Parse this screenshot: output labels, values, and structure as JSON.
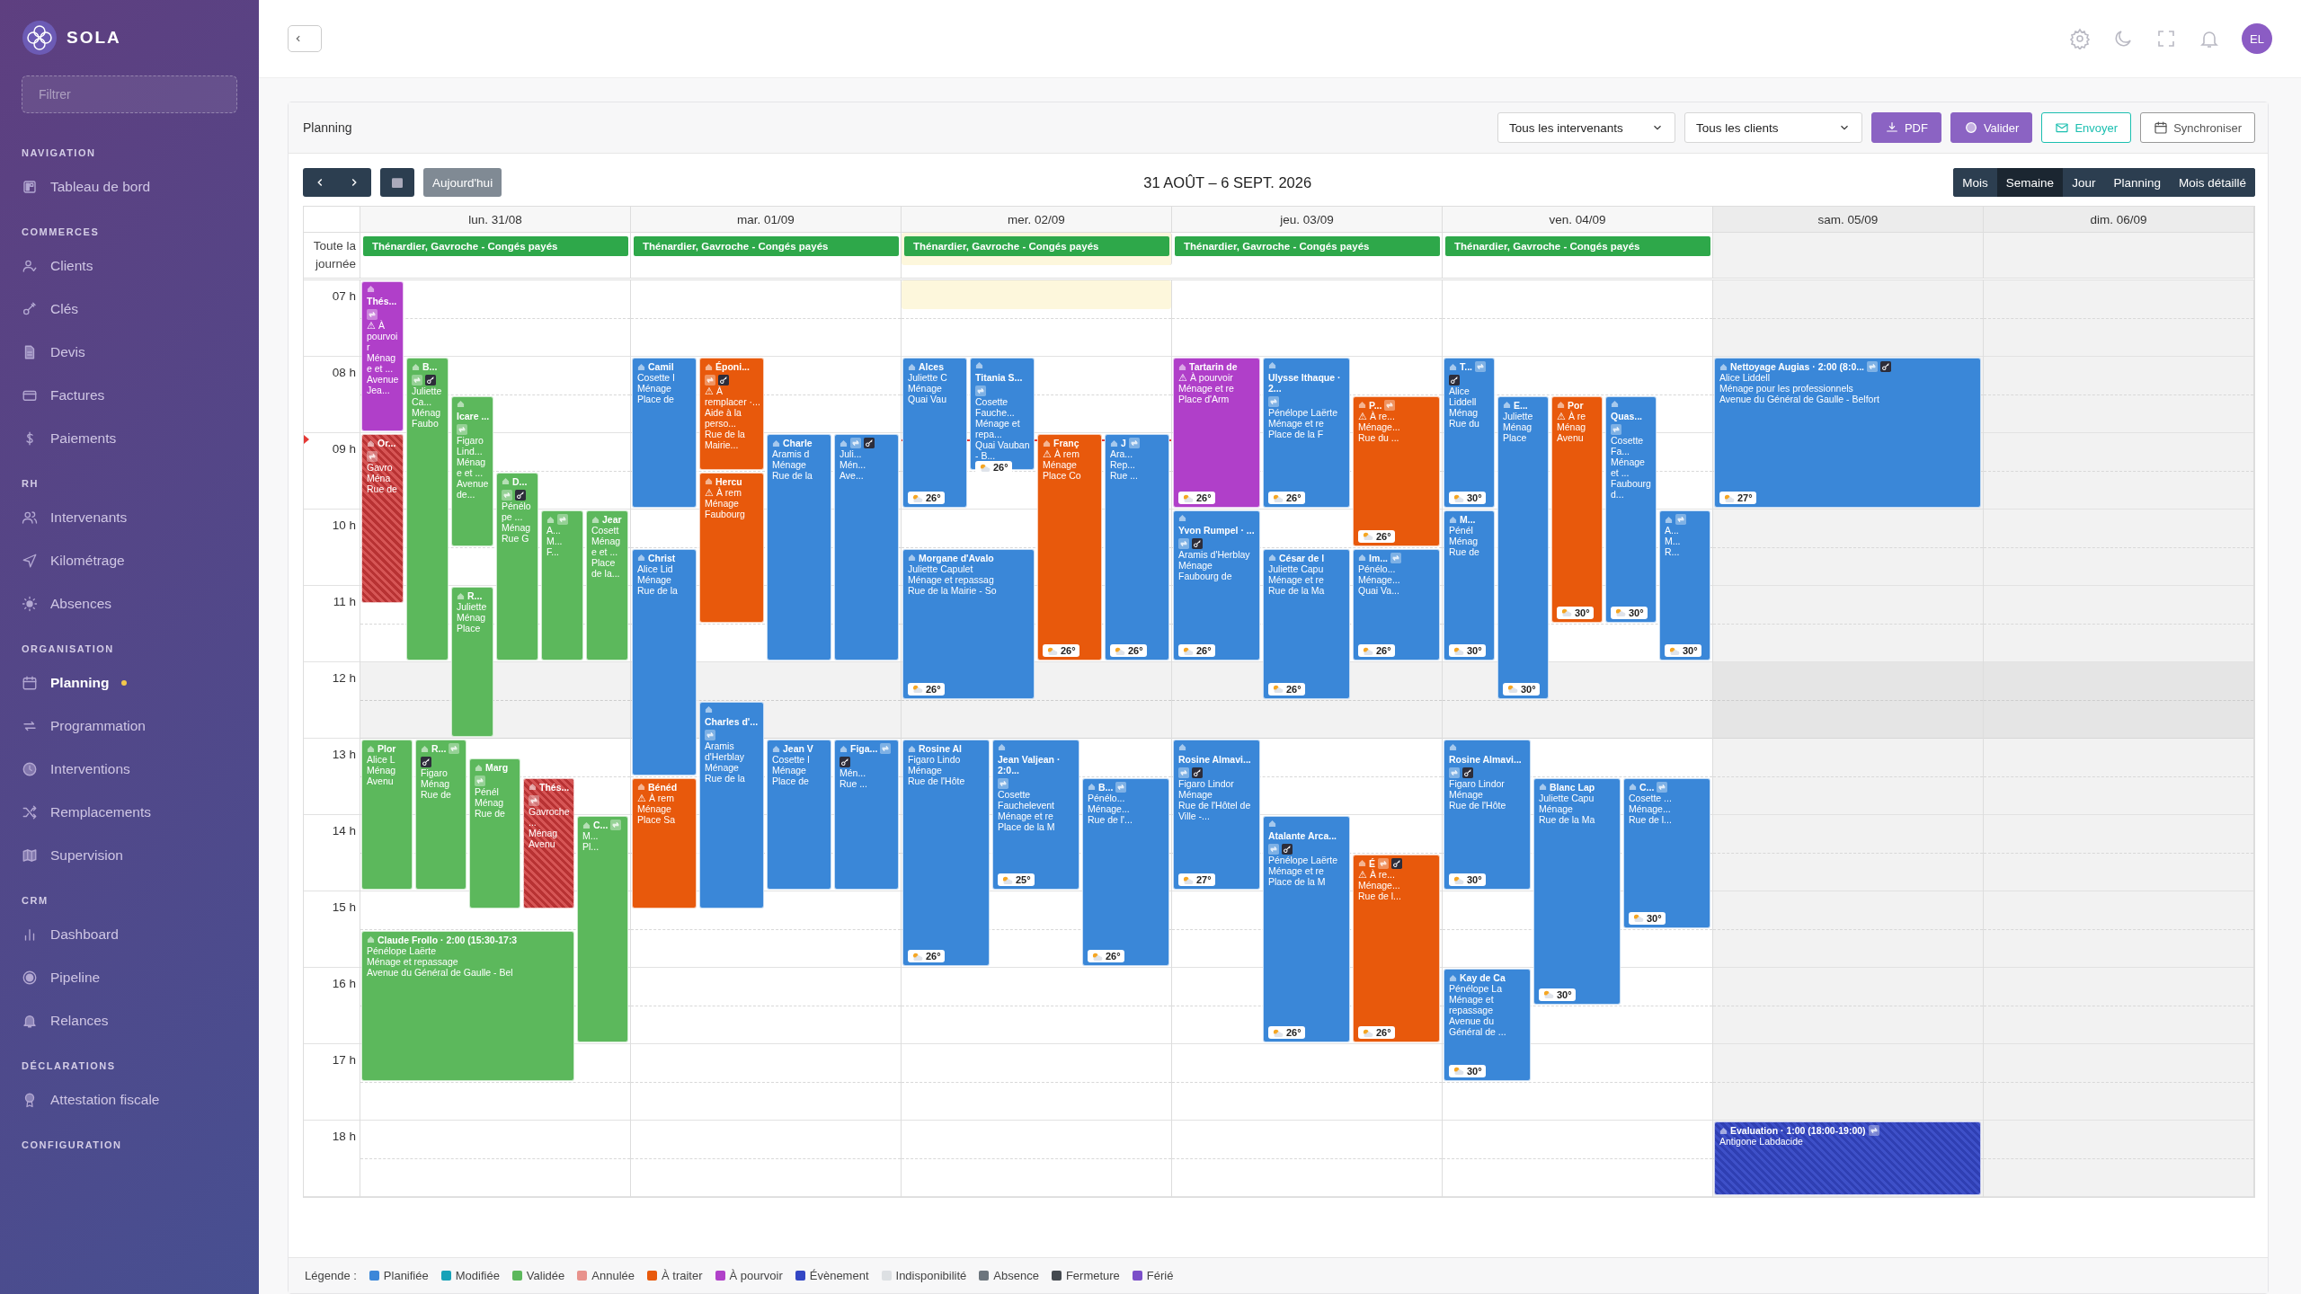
{
  "sidebar": {
    "logo": "SOLA",
    "filter": {
      "placeholder": "Filtrer"
    },
    "sections": [
      {
        "title": "NAVIGATION",
        "items": [
          {
            "label": "Tableau de bord",
            "selected": false,
            "notified": false
          }
        ]
      },
      {
        "title": "COMMERCES",
        "items": [
          {
            "label": "Clients",
            "selected": false,
            "notified": false
          },
          {
            "label": "Clés",
            "selected": false,
            "notified": false
          },
          {
            "label": "Devis",
            "selected": false,
            "notified": false
          },
          {
            "label": "Factures",
            "selected": false,
            "notified": false
          },
          {
            "label": "Paiements",
            "selected": false,
            "notified": false
          }
        ]
      },
      {
        "title": "RH",
        "items": [
          {
            "label": "Intervenants",
            "selected": false,
            "notified": false
          },
          {
            "label": "Kilométrage",
            "selected": false,
            "notified": false
          },
          {
            "label": "Absences",
            "selected": false,
            "notified": false
          }
        ]
      },
      {
        "title": "ORGANISATION",
        "items": [
          {
            "label": "Planning",
            "selected": true,
            "notified": true
          },
          {
            "label": "Programmation",
            "selected": false,
            "notified": false
          },
          {
            "label": "Interventions",
            "selected": false,
            "notified": false
          },
          {
            "label": "Remplacements",
            "selected": false,
            "notified": false
          },
          {
            "label": "Supervision",
            "selected": false,
            "notified": false
          }
        ]
      },
      {
        "title": "CRM",
        "items": [
          {
            "label": "Dashboard",
            "selected": false,
            "notified": false
          },
          {
            "label": "Pipeline",
            "selected": false,
            "notified": false
          },
          {
            "label": "Relances",
            "selected": false,
            "notified": false
          }
        ]
      },
      {
        "title": "DÉCLARATIONS",
        "items": [
          {
            "label": "Attestation fiscale",
            "selected": false,
            "notified": false
          }
        ]
      },
      {
        "title": "CONFIGURATION"
      }
    ]
  },
  "topbar": {
    "avatar": "EL"
  },
  "panel": {
    "title": "Planning",
    "filters": [
      {
        "value": "Tous les intervenants"
      },
      {
        "value": "Tous les clients"
      }
    ],
    "actions": [
      {
        "label": "PDF",
        "kind": "primary"
      },
      {
        "label": "Valider",
        "kind": "primary"
      },
      {
        "label": "Envoyer",
        "kind": "teal"
      },
      {
        "label": "Synchroniser",
        "kind": "outline"
      }
    ],
    "today_button": "Aujourd'hui",
    "range_title": "31 AOÛT – 6 SEPT. 2026",
    "views": [
      {
        "label": "Mois",
        "selected": false
      },
      {
        "label": "Semaine",
        "selected": true
      },
      {
        "label": "Jour",
        "selected": false
      },
      {
        "label": "Planning",
        "selected": false
      },
      {
        "label": "Mois détaillé",
        "selected": false
      }
    ]
  },
  "calendar": {
    "all_day_label": "Toute la journée",
    "hours": [
      "07 h",
      "08 h",
      "09 h",
      "10 h",
      "11 h",
      "12 h",
      "13 h",
      "14 h",
      "15 h",
      "16 h",
      "17 h",
      "18 h"
    ],
    "days": [
      {
        "label": "lun. 31/08",
        "today": false,
        "weekend": false,
        "all_day": [
          "Thénardier, Gavroche - Congés payés"
        ],
        "events": [
          {
            "kind": "a_pourvoir",
            "title": "Thés...",
            "lines": [
              "⚠ À pourvoir",
              "Ménage et ...",
              "Avenue Jea..."
            ],
            "repeat": true,
            "key": false
          },
          {
            "kind": "validee",
            "title": "B...",
            "lines": [
              "Juliette Ca...",
              "Ménag",
              "Faubo"
            ],
            "repeat": true,
            "key": true
          },
          {
            "kind": "annulee",
            "title": "Or...",
            "lines": [
              "Gavro",
              "Ména",
              "Rue de"
            ],
            "repeat": true,
            "key": false
          },
          {
            "kind": "validee",
            "title": "Icare ...",
            "lines": [
              "Figaro Lind...",
              "Ménage et ...",
              "Avenue de..."
            ],
            "repeat": true,
            "key": false
          },
          {
            "kind": "validee",
            "title": "D...",
            "lines": [
              "Pénélope ...",
              "Ménag",
              "Rue G"
            ],
            "repeat": true,
            "key": true
          },
          {
            "kind": "validee",
            "lines": [
              "A...",
              "M...",
              "F..."
            ],
            "repeat": true,
            "key": false
          },
          {
            "kind": "validee",
            "title": "Jear",
            "lines": [
              "Cosett",
              "Ménage et ...",
              "Place de la..."
            ],
            "repeat": false,
            "key": false
          },
          {
            "kind": "validee",
            "title": "R...",
            "lines": [
              "Juliette",
              "Ménag",
              "Place"
            ],
            "repeat": false,
            "key": false
          },
          {
            "kind": "validee",
            "title": "Plor",
            "lines": [
              "Alice L",
              "Ménag",
              "Avenu"
            ],
            "repeat": false,
            "key": false
          },
          {
            "kind": "validee",
            "title": "R...",
            "lines": [
              "Figaro",
              "Ménag",
              "Rue de"
            ],
            "repeat": true,
            "key": true
          },
          {
            "kind": "validee",
            "title": "Marg",
            "lines": [
              "Pénél",
              "Ménag",
              "Rue de"
            ],
            "repeat": true,
            "key": false
          },
          {
            "kind": "annulee",
            "title": "Thés...",
            "lines": [
              "Gavroche ...",
              "Ménag",
              "Avenu"
            ],
            "repeat": true,
            "key": false
          },
          {
            "kind": "validee",
            "title": "C...",
            "lines": [
              "M...",
              "Pl..."
            ],
            "repeat": true,
            "key": false
          },
          {
            "kind": "validee",
            "title": "Claude Frollo · 2:00 (15:30-17:3",
            "lines": [
              "Pénélope Laërte",
              "Ménage et repassage",
              "Avenue du Général de Gaulle - Bel"
            ],
            "repeat": false,
            "key": false
          }
        ]
      },
      {
        "label": "mar. 01/09",
        "today": false,
        "weekend": false,
        "all_day": [
          "Thénardier, Gavroche - Congés payés"
        ],
        "events": [
          {
            "kind": "planifiee",
            "title": "Camil",
            "lines": [
              "Cosette I",
              "Ménage",
              "Place de"
            ],
            "repeat": false,
            "key": false
          },
          {
            "kind": "a_traiter",
            "title": "Époni...",
            "lines": [
              "⚠ À remplacer ·...",
              "Aide à la perso...",
              "Rue de la Mairie..."
            ],
            "repeat": true,
            "key": true
          },
          {
            "kind": "planifiee",
            "title": "Charle",
            "lines": [
              "Aramis d",
              "Ménage",
              "Rue de la"
            ],
            "repeat": false,
            "key": false
          },
          {
            "kind": "planifiee",
            "lines": [
              "Juli...",
              "Mén...",
              "Ave..."
            ],
            "repeat": true,
            "key": true
          },
          {
            "kind": "a_traiter",
            "title": "Hercu",
            "lines": [
              "⚠ À rem",
              "Ménage",
              "Faubourg"
            ],
            "repeat": false,
            "key": false
          },
          {
            "kind": "planifiee",
            "title": "Christ",
            "lines": [
              "Alice Lid",
              "Ménage",
              "Rue de la"
            ],
            "repeat": false,
            "key": false
          },
          {
            "kind": "planifiee",
            "title": "Charles d'...",
            "lines": [
              "Aramis d'Herblay",
              "Ménage",
              "Rue de la"
            ],
            "repeat": true,
            "key": false
          },
          {
            "kind": "planifiee",
            "title": "Jean V",
            "lines": [
              "Cosette I",
              "Ménage",
              "Place de"
            ],
            "repeat": false,
            "key": false
          },
          {
            "kind": "planifiee",
            "title": "Figa...",
            "lines": [
              "Mén...",
              "Rue ..."
            ],
            "repeat": true,
            "key": true
          },
          {
            "kind": "a_traiter",
            "title": "Bénéd",
            "lines": [
              "⚠ À rem",
              "Ménage",
              "Place Sa"
            ],
            "repeat": false,
            "key": false
          }
        ]
      },
      {
        "label": "mer. 02/09",
        "today": true,
        "weekend": false,
        "all_day": [
          "Thénardier, Gavroche - Congés payés"
        ],
        "events": [
          {
            "kind": "planifiee",
            "title": "Alces",
            "lines": [
              "Juliette C",
              "Ménage",
              "Quai Vau"
            ],
            "repeat": false,
            "key": false,
            "weather": "26°"
          },
          {
            "kind": "planifiee",
            "title": "Titania S...",
            "lines": [
              "Cosette Fauche...",
              "Ménage et repa...",
              "Quai Vauban - B..."
            ],
            "repeat": true,
            "key": false,
            "weather": "26°"
          },
          {
            "kind": "a_traiter",
            "title": "Franç",
            "lines": [
              "⚠ À rem",
              "Ménage",
              "Place Co"
            ],
            "repeat": false,
            "key": false,
            "weather": "26°"
          },
          {
            "kind": "planifiee",
            "title": "J",
            "lines": [
              "Ara...",
              "Rep...",
              "Rue ..."
            ],
            "repeat": true,
            "key": false,
            "weather": "26°"
          },
          {
            "kind": "planifiee",
            "title": "Morgane d'Avalo",
            "lines": [
              "Juliette Capulet",
              "Ménage et repassag",
              "Rue de la Mairie - So"
            ],
            "repeat": false,
            "key": false,
            "weather": "26°"
          },
          {
            "kind": "planifiee",
            "title": "Rosine Al",
            "lines": [
              "Figaro Lindo",
              "Ménage",
              "Rue de l'Hôte"
            ],
            "repeat": false,
            "key": false,
            "weather": "26°"
          },
          {
            "kind": "planifiee",
            "title": "Jean Valjean · 2:0...",
            "lines": [
              "Cosette Fauchelevent",
              "Ménage et re",
              "Place de la M"
            ],
            "repeat": true,
            "key": false,
            "weather": "25°"
          },
          {
            "kind": "planifiee",
            "title": "B...",
            "lines": [
              "Pénélo...",
              "Ménage...",
              "Rue de l'..."
            ],
            "repeat": true,
            "key": false,
            "weather": "26°"
          }
        ]
      },
      {
        "label": "jeu. 03/09",
        "today": false,
        "weekend": false,
        "all_day": [
          "Thénardier, Gavroche - Congés payés"
        ],
        "events": [
          {
            "kind": "a_pourvoir",
            "title": "Tartarin de",
            "lines": [
              "⚠ À pourvoir",
              "Ménage et re",
              "Place d'Arm"
            ],
            "repeat": false,
            "key": false,
            "weather": "26°"
          },
          {
            "kind": "planifiee",
            "title": "Ulysse Ithaque · 2...",
            "lines": [
              "Pénélope Laërte",
              "Ménage et re",
              "Place de la F"
            ],
            "repeat": true,
            "key": false,
            "weather": "26°"
          },
          {
            "kind": "a_traiter",
            "title": "P...",
            "lines": [
              "⚠ À re...",
              "Ménage...",
              "Rue du ..."
            ],
            "repeat": true,
            "key": false,
            "weather": "26°"
          },
          {
            "kind": "planifiee",
            "title": "Yvon Rumpel · ...",
            "lines": [
              "Aramis d'Herblay",
              "Ménage",
              "Faubourg de"
            ],
            "repeat": true,
            "key": true,
            "weather": "26°"
          },
          {
            "kind": "planifiee",
            "title": "César de l",
            "lines": [
              "Juliette Capu",
              "Ménage et re",
              "Rue de la Ma"
            ],
            "repeat": false,
            "key": false,
            "weather": "26°"
          },
          {
            "kind": "planifiee",
            "title": "Im...",
            "lines": [
              "Pénélo...",
              "Ménage...",
              "Quai Va..."
            ],
            "repeat": true,
            "key": false,
            "weather": "26°"
          },
          {
            "kind": "planifiee",
            "title": "Rosine Almavi...",
            "lines": [
              "Figaro Lindor",
              "Ménage",
              "Rue de l'Hôtel de Ville -..."
            ],
            "repeat": true,
            "key": true,
            "weather": "27°"
          },
          {
            "kind": "planifiee",
            "title": "Atalante Arca...",
            "lines": [
              "Pénélope Laërte",
              "Ménage et re",
              "Place de la M"
            ],
            "repeat": true,
            "key": true,
            "weather": "26°"
          },
          {
            "kind": "a_traiter",
            "title": "É",
            "lines": [
              "⚠ À re...",
              "Ménage...",
              "Rue de l..."
            ],
            "repeat": true,
            "key": true,
            "weather": "26°"
          }
        ]
      },
      {
        "label": "ven. 04/09",
        "today": false,
        "weekend": false,
        "all_day": [
          "Thénardier, Gavroche - Congés payés"
        ],
        "events": [
          {
            "kind": "planifiee",
            "title": "T...",
            "lines": [
              "Alice Liddell",
              "Ménag",
              "Rue du"
            ],
            "repeat": true,
            "key": true,
            "weather": "30°"
          },
          {
            "kind": "planifiee",
            "title": "E...",
            "lines": [
              "Juliette",
              "Ménag",
              "Place"
            ],
            "repeat": false,
            "key": false,
            "weather": "30°"
          },
          {
            "kind": "a_traiter",
            "title": "Por",
            "lines": [
              "⚠ À re",
              "Ménag",
              "Avenu"
            ],
            "repeat": false,
            "key": false,
            "weather": "30°"
          },
          {
            "kind": "planifiee",
            "title": "Quas...",
            "lines": [
              "Cosette Fa...",
              "Ménage et ...",
              "Faubourg d..."
            ],
            "repeat": true,
            "key": false,
            "weather": "30°"
          },
          {
            "kind": "planifiee",
            "title": "M...",
            "lines": [
              "Pénél",
              "Ménag",
              "Rue de"
            ],
            "repeat": false,
            "key": false,
            "weather": "30°"
          },
          {
            "kind": "planifiee",
            "lines": [
              "A...",
              "M...",
              "R..."
            ],
            "repeat": true,
            "key": false,
            "weather": "30°"
          },
          {
            "kind": "planifiee",
            "title": "Rosine Almavi...",
            "lines": [
              "Figaro Lindor",
              "Ménage",
              "Rue de l'Hôte"
            ],
            "repeat": true,
            "key": true,
            "weather": "30°"
          },
          {
            "kind": "planifiee",
            "title": "Blanc Lap",
            "lines": [
              "Juliette Capu",
              "Ménage",
              "Rue de la Ma"
            ],
            "repeat": false,
            "key": false,
            "weather": "30°"
          },
          {
            "kind": "planifiee",
            "title": "C...",
            "lines": [
              "Cosette ...",
              "Ménage...",
              "Rue de l..."
            ],
            "repeat": true,
            "key": false,
            "weather": "30°"
          },
          {
            "kind": "planifiee",
            "title": "Kay de Ca",
            "lines": [
              "Pénélope La",
              "Ménage et repassage",
              "Avenue du Général de ..."
            ],
            "repeat": false,
            "key": false,
            "weather": "30°"
          }
        ]
      },
      {
        "label": "sam. 05/09",
        "today": false,
        "weekend": true,
        "events": [
          {
            "kind": "planifiee",
            "title": "Nettoyage Augias · 2:00 (8:0...",
            "lines": [
              "Alice Liddell",
              "Ménage pour les professionnels",
              "Avenue du Général de Gaulle - Belfort"
            ],
            "repeat": true,
            "key": true,
            "weather": "27°"
          },
          {
            "kind": "evenement",
            "title": "Evaluation · 1:00 (18:00-19:00)",
            "lines": [
              "Antigone Labdacide"
            ],
            "repeat": true,
            "key": false
          }
        ]
      },
      {
        "label": "dim. 06/09",
        "today": false,
        "weekend": true
      }
    ]
  },
  "legend": {
    "title": "Légende :",
    "items": [
      {
        "label": "Planifiée",
        "color": "#3b87d9"
      },
      {
        "label": "Modifiée",
        "color": "#17a2b8"
      },
      {
        "label": "Validée",
        "color": "#5cb85c"
      },
      {
        "label": "Annulée",
        "color": "#e8928c"
      },
      {
        "label": "À traiter",
        "color": "#e8590c"
      },
      {
        "label": "À pourvoir",
        "color": "#b041c9"
      },
      {
        "label": "Évènement",
        "color": "#3346c4"
      },
      {
        "label": "Indisponibilité",
        "color": "#dde0e3"
      },
      {
        "label": "Absence",
        "color": "#6c757d"
      },
      {
        "label": "Fermeture",
        "color": "#454a50"
      },
      {
        "label": "Férié",
        "color": "#7b4fc9"
      }
    ]
  }
}
